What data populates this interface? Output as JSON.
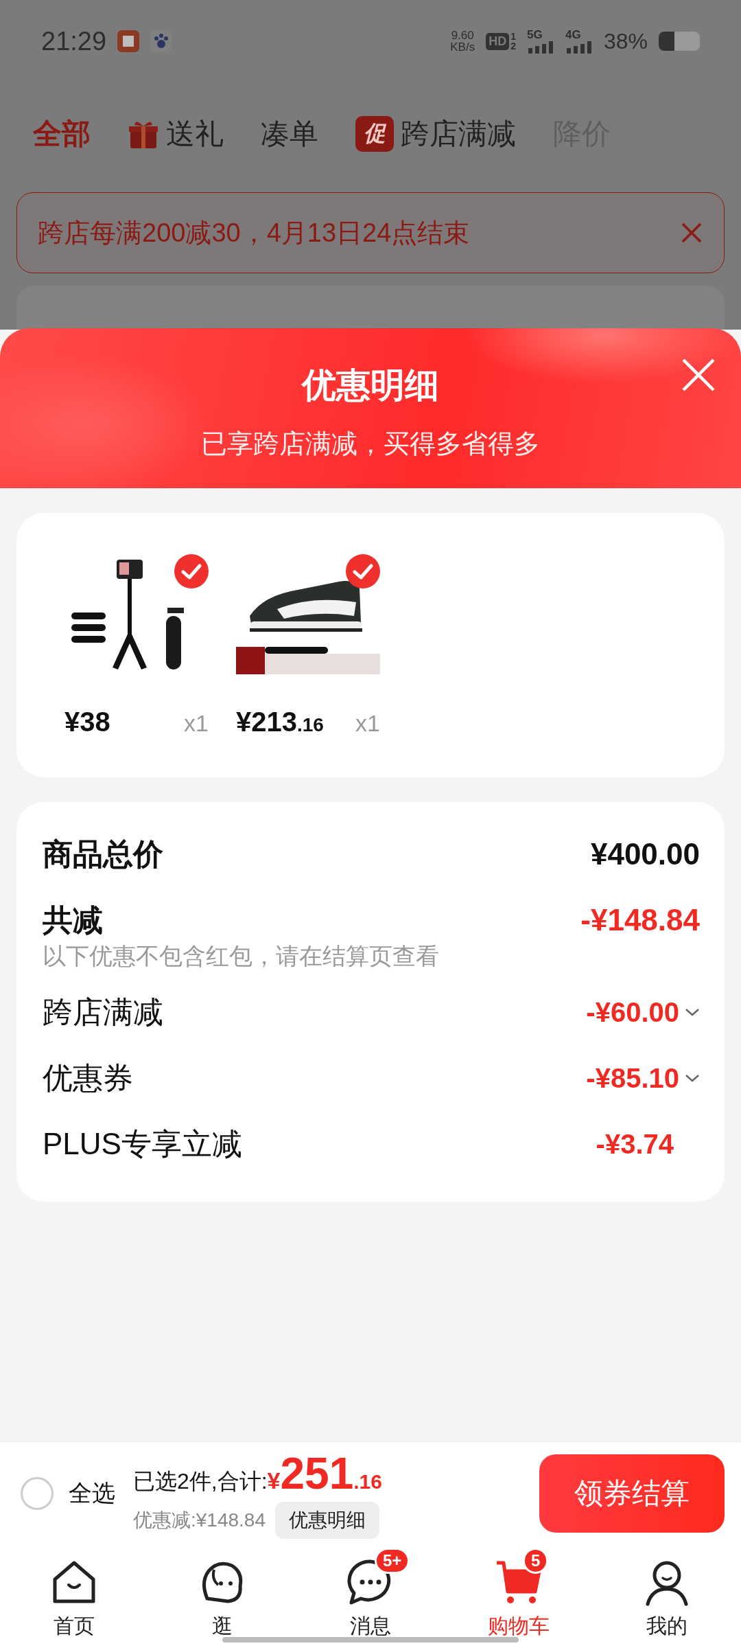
{
  "status_bar": {
    "time": "21:29",
    "net_speed": "9.60",
    "net_unit": "KB/s",
    "hd": "HD",
    "hd_sub_1": "1",
    "hd_sub_2": "2",
    "sim_1": "5G",
    "sim_2": "4G",
    "battery": "38%"
  },
  "tabs": [
    {
      "label": "全部",
      "selected": true,
      "kind": "plain"
    },
    {
      "label": "送礼",
      "selected": false,
      "kind": "gift"
    },
    {
      "label": "凑单",
      "selected": false,
      "kind": "plain"
    },
    {
      "label": "跨店满减",
      "selected": false,
      "kind": "promo",
      "badge": "促"
    },
    {
      "label": "降价",
      "selected": false,
      "kind": "muted"
    }
  ],
  "banner": {
    "text": "跨店每满200减30，4月13日24点结束"
  },
  "sheet": {
    "title": "优惠明细",
    "subtitle": "已享跨店满减，买得多省得多"
  },
  "products": [
    {
      "kind": "tripod",
      "checked": true,
      "price_main": "¥38",
      "quantity": "x1"
    },
    {
      "kind": "shoe",
      "checked": true,
      "price_main": "¥213",
      "price_cents": ".16",
      "quantity": "x1"
    }
  ],
  "summary": [
    {
      "kind": "total",
      "label": "商品总价",
      "value": "¥400.00"
    },
    {
      "kind": "discount",
      "label": "共减",
      "value": "-¥148.84",
      "note": "以下优惠不包含红包，请在结算页查看"
    },
    {
      "kind": "detail",
      "label": "跨店满减",
      "value": "-¥60.00",
      "expandable": true
    },
    {
      "kind": "detail",
      "label": "优惠券",
      "value": "-¥85.10",
      "expandable": true
    },
    {
      "kind": "detail",
      "label": "PLUS专享立减",
      "value": "-¥3.74",
      "expandable": false
    }
  ],
  "checkout": {
    "select_all": "全选",
    "select_all_checked": false,
    "summary_label": "已选2件,合计:",
    "currency": "¥",
    "total_main": "251",
    "total_cents": ".16",
    "discount": "优惠减:¥148.84",
    "details_button": "优惠明细",
    "checkout_button": "领券结算"
  },
  "nav": [
    {
      "label": "首页",
      "selected": false
    },
    {
      "label": "逛",
      "selected": false
    },
    {
      "label": "消息",
      "selected": false,
      "badge": "5+"
    },
    {
      "label": "购物车",
      "selected": true,
      "badge": "5"
    },
    {
      "label": "我的",
      "selected": false
    }
  ]
}
